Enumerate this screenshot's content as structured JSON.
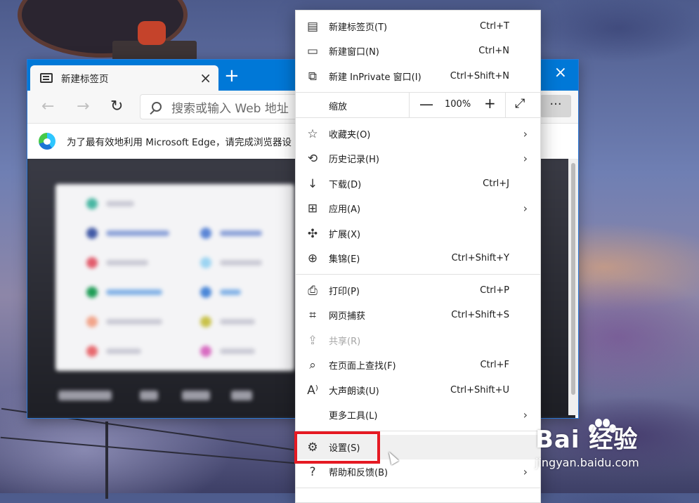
{
  "browser": {
    "tab_title": "新建标签页",
    "address_placeholder": "搜索或输入 Web 地址",
    "info_text": "为了最有效地利用 Microsoft Edge，请完成浏览器设",
    "more_label": "···"
  },
  "menu": {
    "top_items": [
      {
        "icon": "new-tab-icon",
        "label": "新建标签页(T)",
        "shortcut": "Ctrl+T"
      },
      {
        "icon": "new-window-icon",
        "label": "新建窗口(N)",
        "shortcut": "Ctrl+N"
      },
      {
        "icon": "inprivate-window-icon",
        "label": "新建 InPrivate 窗口(I)",
        "shortcut": "Ctrl+Shift+N"
      }
    ],
    "zoom": {
      "label": "缩放",
      "minus": "—",
      "value": "100%",
      "plus": "+"
    },
    "middle_items": [
      {
        "icon": "favorites-icon",
        "label": "收藏夹(O)",
        "shortcut": "",
        "submenu": true
      },
      {
        "icon": "history-icon",
        "label": "历史记录(H)",
        "shortcut": "",
        "submenu": true
      },
      {
        "icon": "download-icon",
        "label": "下载(D)",
        "shortcut": "Ctrl+J",
        "submenu": false
      },
      {
        "icon": "apps-icon",
        "label": "应用(A)",
        "shortcut": "",
        "submenu": true
      },
      {
        "icon": "extensions-icon",
        "label": "扩展(X)",
        "shortcut": "",
        "submenu": false
      },
      {
        "icon": "collections-icon",
        "label": "集锦(E)",
        "shortcut": "Ctrl+Shift+Y",
        "submenu": false
      }
    ],
    "lower_items": [
      {
        "icon": "print-icon",
        "label": "打印(P)",
        "shortcut": "Ctrl+P",
        "submenu": false,
        "disabled": false
      },
      {
        "icon": "web-capture-icon",
        "label": "网页捕获",
        "shortcut": "Ctrl+Shift+S",
        "submenu": false,
        "disabled": false
      },
      {
        "icon": "share-icon",
        "label": "共享(R)",
        "shortcut": "",
        "submenu": false,
        "disabled": true
      },
      {
        "icon": "find-on-page-icon",
        "label": "在页面上查找(F)",
        "shortcut": "Ctrl+F",
        "submenu": false,
        "disabled": false
      },
      {
        "icon": "read-aloud-icon",
        "label": "大声朗读(U)",
        "shortcut": "Ctrl+Shift+U",
        "submenu": false,
        "disabled": false
      },
      {
        "icon": "",
        "label": "更多工具(L)",
        "shortcut": "",
        "submenu": true,
        "disabled": false
      }
    ],
    "bottom_items": [
      {
        "icon": "gear-icon",
        "label": "设置(S)",
        "shortcut": "",
        "submenu": false
      },
      {
        "icon": "help-icon",
        "label": "帮助和反馈(B)",
        "shortcut": "",
        "submenu": true
      }
    ]
  },
  "watermark": {
    "brand": "Bai 经验",
    "url": "jingyan.baidu.com"
  },
  "colors": {
    "accent": "#0078d7",
    "highlight": "#e51a23"
  }
}
